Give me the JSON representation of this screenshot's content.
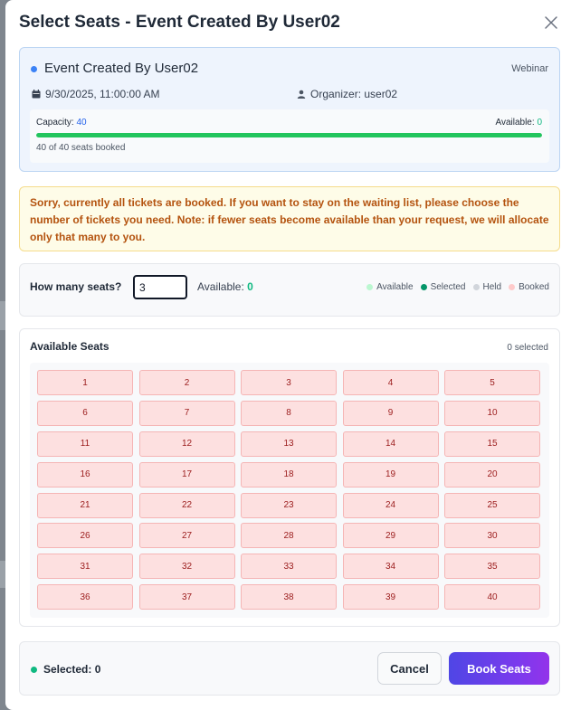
{
  "modal": {
    "title": "Select Seats - Event Created By User02"
  },
  "event": {
    "name": "Event Created By User02",
    "type": "Webinar",
    "datetime": "9/30/2025, 11:00:00 AM",
    "organizer": "Organizer: user02",
    "capacity_label": "Capacity: ",
    "capacity_value": "40",
    "available_label": "Available: ",
    "available_value": "0",
    "booked_text": "40 of 40 seats booked",
    "booked_fraction": 1.0
  },
  "warning": {
    "text": "Sorry, currently all tickets are booked. If you want to stay on the waiting list, please choose the number of tickets you need. Note: if fewer seats become available than your request, we will allocate only that many to you."
  },
  "seat_count": {
    "label": "How many seats?",
    "value": "3",
    "available_label": "Available: ",
    "available_value": "0"
  },
  "legend": [
    {
      "label": "Available",
      "color": "#bbf7d0"
    },
    {
      "label": "Selected",
      "color": "#059669"
    },
    {
      "label": "Held",
      "color": "#d1d5db"
    },
    {
      "label": "Booked",
      "color": "#fecaca"
    }
  ],
  "seats": {
    "title": "Available Seats",
    "selected_count": "0 selected",
    "items": [
      "1",
      "2",
      "3",
      "4",
      "5",
      "6",
      "7",
      "8",
      "9",
      "10",
      "11",
      "12",
      "13",
      "14",
      "15",
      "16",
      "17",
      "18",
      "19",
      "20",
      "21",
      "22",
      "23",
      "24",
      "25",
      "26",
      "27",
      "28",
      "29",
      "30",
      "31",
      "32",
      "33",
      "34",
      "35",
      "36",
      "37",
      "38",
      "39",
      "40"
    ]
  },
  "footer": {
    "selected_text": "Selected: 0",
    "cancel_label": "Cancel",
    "book_label": "Book Seats"
  },
  "colors": {
    "accent": "#3b82f6",
    "booked_seat_bg": "#fde0e0",
    "booked_seat_text": "#9b1c1c",
    "primary_button": "#6d3aed"
  }
}
